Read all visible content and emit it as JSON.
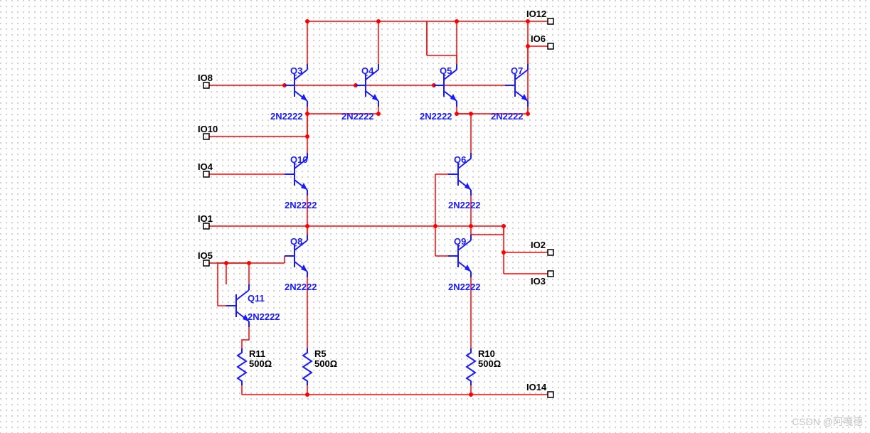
{
  "watermark": "CSDN @阿嘎德",
  "ports": {
    "IO12": "IO12",
    "IO6": "IO6",
    "IO8": "IO8",
    "IO10": "IO10",
    "IO4": "IO4",
    "IO1": "IO1",
    "IO5": "IO5",
    "IO2": "IO2",
    "IO3": "IO3",
    "IO14": "IO14"
  },
  "transistors": {
    "Q3": {
      "ref": "Q3",
      "model": "2N2222"
    },
    "Q4": {
      "ref": "Q4",
      "model": "2N2222"
    },
    "Q5": {
      "ref": "Q5",
      "model": "2N2222"
    },
    "Q7": {
      "ref": "Q7",
      "model": "2N2222"
    },
    "Q10": {
      "ref": "Q10",
      "model": "2N2222"
    },
    "Q6": {
      "ref": "Q6",
      "model": "2N2222"
    },
    "Q8": {
      "ref": "Q8",
      "model": "2N2222"
    },
    "Q9": {
      "ref": "Q9",
      "model": "2N2222"
    },
    "Q11": {
      "ref": "Q11",
      "model": "2N2222"
    }
  },
  "resistors": {
    "R11": {
      "ref": "R11",
      "value": "500Ω"
    },
    "R5": {
      "ref": "R5",
      "value": "500Ω"
    },
    "R10": {
      "ref": "R10",
      "value": "500Ω"
    }
  },
  "chart_data": {
    "type": "schematic",
    "components": [
      {
        "ref": "Q3",
        "type": "NPN-BJT",
        "model": "2N2222"
      },
      {
        "ref": "Q4",
        "type": "NPN-BJT",
        "model": "2N2222"
      },
      {
        "ref": "Q5",
        "type": "NPN-BJT",
        "model": "2N2222"
      },
      {
        "ref": "Q7",
        "type": "NPN-BJT",
        "model": "2N2222"
      },
      {
        "ref": "Q10",
        "type": "NPN-BJT",
        "model": "2N2222"
      },
      {
        "ref": "Q6",
        "type": "NPN-BJT",
        "model": "2N2222"
      },
      {
        "ref": "Q8",
        "type": "NPN-BJT",
        "model": "2N2222"
      },
      {
        "ref": "Q9",
        "type": "NPN-BJT",
        "model": "2N2222"
      },
      {
        "ref": "Q11",
        "type": "NPN-BJT",
        "model": "2N2222"
      },
      {
        "ref": "R11",
        "type": "Resistor",
        "value": 500,
        "unit": "Ω"
      },
      {
        "ref": "R5",
        "type": "Resistor",
        "value": 500,
        "unit": "Ω"
      },
      {
        "ref": "R10",
        "type": "Resistor",
        "value": 500,
        "unit": "Ω"
      }
    ],
    "ports": [
      "IO1",
      "IO2",
      "IO3",
      "IO4",
      "IO5",
      "IO6",
      "IO8",
      "IO10",
      "IO12",
      "IO14"
    ],
    "nets": [
      {
        "name": "IO12",
        "pins": [
          "port:IO12",
          "Q3:C",
          "Q4:C",
          "Q5:C",
          "Q7:C"
        ]
      },
      {
        "name": "IO6",
        "pins": [
          "port:IO6",
          "Q7:E",
          "Q6:C",
          "Q9:C",
          "port:IO3"
        ]
      },
      {
        "name": "IO8",
        "pins": [
          "port:IO8",
          "Q3:B",
          "Q4:B",
          "Q5:B",
          "Q7:B"
        ]
      },
      {
        "name": "IO10",
        "pins": [
          "port:IO10",
          "Q3:E",
          "Q4:E",
          "Q10:C",
          "Q8:C",
          "port:IO2"
        ]
      },
      {
        "name": "IO4",
        "pins": [
          "port:IO4",
          "Q10:B"
        ]
      },
      {
        "name": "IO1",
        "pins": [
          "port:IO1",
          "Q10:E",
          "Q5:E",
          "Q8:B",
          "Q6:B",
          "Q6:E",
          "Q9:B"
        ]
      },
      {
        "name": "IO5",
        "pins": [
          "port:IO5",
          "Q11:C",
          "Q11:B",
          "Q8:E",
          "R11:1"
        ]
      },
      {
        "name": "N_Q9E",
        "pins": [
          "Q9:E",
          "R10:1"
        ]
      },
      {
        "name": "N_Q11E",
        "pins": [
          "Q11:E",
          "R5:1"
        ]
      },
      {
        "name": "IO14",
        "pins": [
          "port:IO14",
          "R11:2",
          "R5:2",
          "R10:2"
        ]
      }
    ]
  }
}
